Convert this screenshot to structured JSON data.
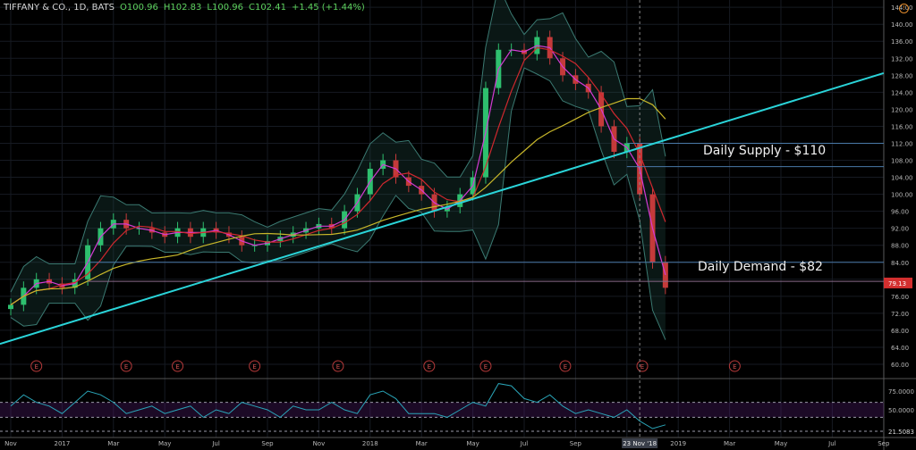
{
  "header": {
    "symbol": "TIFFANY & CO., 1D, BATS",
    "open": "O100.96",
    "high": "H102.83",
    "low": "L100.96",
    "close": "C102.41",
    "change": "+1.45 (+1.44%)"
  },
  "annotations": {
    "supply": "Daily Supply - $110",
    "demand": "Daily Demand - $82"
  },
  "alert_icon": "!",
  "crosshair_label": "23 Nov '18",
  "colors": {
    "trend": "#2ad4d9",
    "ma_fast": "#d43bd4",
    "ma_mid": "#d0282e",
    "ma_slow": "#c8b72a",
    "band": "#3b7a72",
    "rsi": "#2aa5b8",
    "up": "#2ebf6e",
    "down": "#c43a3a",
    "price_tag": "#d32f2f"
  },
  "chart_data": {
    "type": "candlestick",
    "title": "TIFFANY & CO., 1D, BATS",
    "time_unit": "half-months since Nov 2016",
    "price_axis": {
      "min": 60,
      "max": 144,
      "ticks": [
        "144.00",
        "140.00",
        "136.00",
        "132.00",
        "128.00",
        "124.00",
        "120.00",
        "116.00",
        "112.00",
        "108.00",
        "104.00",
        "100.00",
        "96.00",
        "92.00",
        "88.00",
        "84.00",
        "80.00",
        "76.00",
        "72.00",
        "68.00",
        "64.00",
        "60.00"
      ]
    },
    "x_ticks": [
      {
        "label": "Nov",
        "t": 0
      },
      {
        "label": "2017",
        "t": 4
      },
      {
        "label": "Mar",
        "t": 8
      },
      {
        "label": "May",
        "t": 12
      },
      {
        "label": "Jul",
        "t": 16
      },
      {
        "label": "Sep",
        "t": 20
      },
      {
        "label": "Nov",
        "t": 24
      },
      {
        "label": "2018",
        "t": 28
      },
      {
        "label": "Mar",
        "t": 32
      },
      {
        "label": "May",
        "t": 36
      },
      {
        "label": "Jul",
        "t": 40
      },
      {
        "label": "Sep",
        "t": 44
      },
      {
        "label": "No",
        "t": 48
      },
      {
        "label": "2019",
        "t": 52
      },
      {
        "label": "Mar",
        "t": 56
      },
      {
        "label": "May",
        "t": 60
      },
      {
        "label": "Jul",
        "t": 64
      },
      {
        "label": "Sep",
        "t": 68
      }
    ],
    "closes": [
      74,
      78,
      80,
      79,
      78,
      80,
      88,
      92,
      94,
      92,
      92,
      91,
      90,
      92,
      90,
      92,
      91,
      90,
      88,
      88,
      89,
      90,
      91,
      92,
      93,
      92,
      96,
      100,
      106,
      108,
      104,
      102,
      100,
      96,
      97,
      100,
      104,
      125,
      134,
      134,
      133,
      137,
      132,
      128,
      126,
      124,
      116,
      110,
      112,
      100,
      84,
      78
    ],
    "current_price": "79.13",
    "trendline": {
      "from": {
        "t": -0.84,
        "price": 64.8
      },
      "to": {
        "t": 68,
        "price": 128.5
      }
    },
    "levels": [
      112,
      106.5,
      84,
      79.5
    ],
    "earnings_marks": {
      "label": "E",
      "t": [
        2,
        9,
        13,
        19,
        25.5,
        32.6,
        37,
        43.2,
        49.2,
        56.4
      ]
    },
    "rsi": {
      "axis_ticks": [
        "75.0000",
        "50.0000"
      ],
      "current": "21.5083",
      "bands": [
        60,
        40
      ],
      "values": [
        55,
        70,
        60,
        55,
        45,
        60,
        75,
        70,
        60,
        45,
        50,
        55,
        45,
        50,
        55,
        40,
        50,
        45,
        60,
        55,
        50,
        40,
        55,
        50,
        50,
        60,
        50,
        45,
        70,
        75,
        65,
        45,
        45,
        45,
        40,
        50,
        60,
        55,
        85,
        82,
        65,
        60,
        70,
        55,
        45,
        50,
        45,
        40,
        50,
        35,
        25,
        30
      ]
    },
    "crosshair_t": 49
  }
}
